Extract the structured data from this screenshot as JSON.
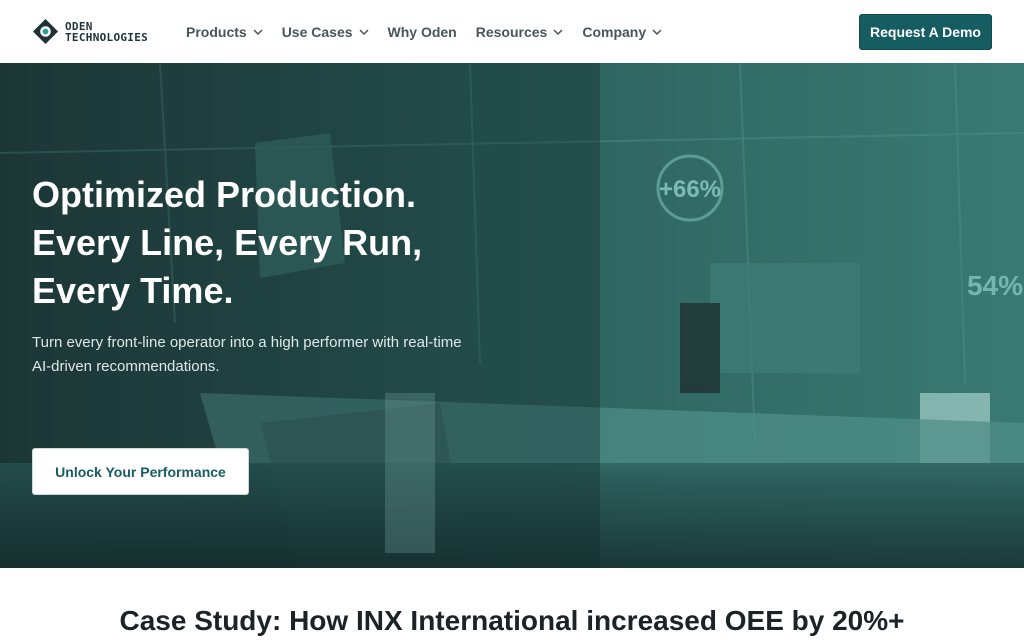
{
  "header": {
    "logo": {
      "line1": "ODEN",
      "line2": "TECHNOLOGIES"
    },
    "nav": [
      {
        "label": "Products",
        "dropdown": true
      },
      {
        "label": "Use Cases",
        "dropdown": true
      },
      {
        "label": "Why Oden",
        "dropdown": false
      },
      {
        "label": "Resources",
        "dropdown": true
      },
      {
        "label": "Company",
        "dropdown": true
      }
    ],
    "cta_label": "Request A Demo"
  },
  "hero": {
    "title_lines": [
      "Optimized Production.",
      "Every Line, Every Run,",
      "Every Time."
    ],
    "subtitle": "Turn every front-line operator into a high performer with real-time AI-driven recommendations.",
    "button_label": "Unlock Your Performance",
    "overlay_readouts": [
      "+66%",
      "54%"
    ]
  },
  "case_study": {
    "title": "Case Study: How INX International increased OEE by 20%+"
  },
  "colors": {
    "brand": "#165d61",
    "hero_tint": "#1f4a4a",
    "text_dark": "#1c2326",
    "nav_text": "#4a5559"
  },
  "icons": {
    "logo": "oden-diamond-eye-icon",
    "dropdown": "chevron-down-icon"
  }
}
